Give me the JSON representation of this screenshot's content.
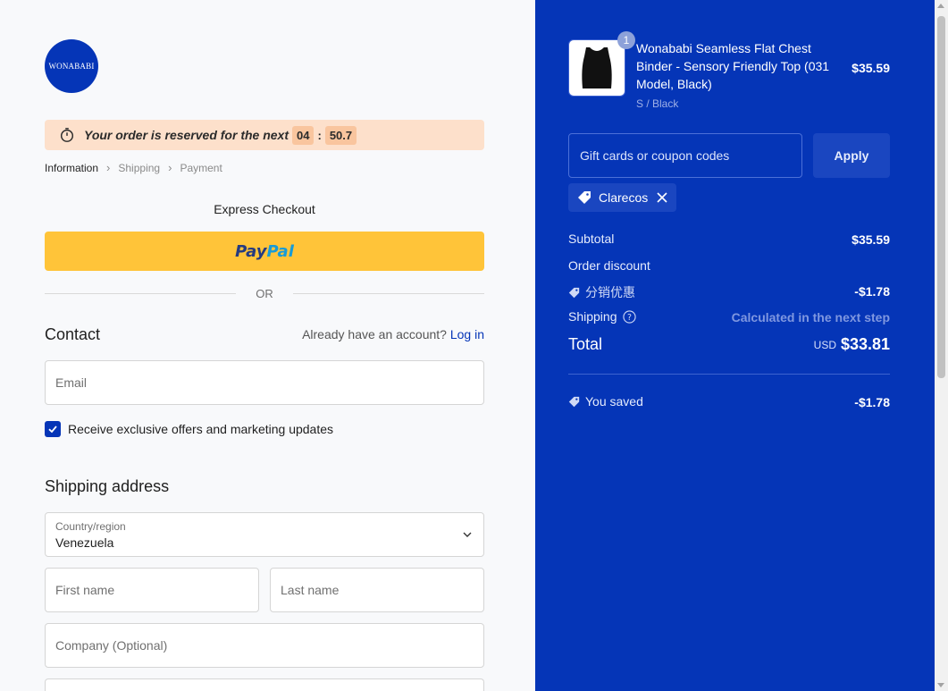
{
  "brand": {
    "logo_text": "WONABABI"
  },
  "timer": {
    "message": "Your order is reserved for the next",
    "minutes": "04",
    "separator": ":",
    "seconds": "50.7"
  },
  "breadcrumb": {
    "items": [
      "Information",
      "Shipping",
      "Payment"
    ]
  },
  "express": {
    "title": "Express Checkout",
    "paypal_pay": "Pay",
    "paypal_pal": "Pal"
  },
  "divider": {
    "or_text": "OR"
  },
  "contact": {
    "title": "Contact",
    "account_prompt": "Already have an account?",
    "login_label": "Log in",
    "email_placeholder": "Email",
    "marketing_label": "Receive exclusive offers and marketing updates",
    "marketing_checked": true
  },
  "shipping": {
    "title": "Shipping address",
    "country_label": "Country/region",
    "country_value": "Venezuela",
    "first_name_placeholder": "First name",
    "last_name_placeholder": "Last name",
    "company_placeholder": "Company (Optional)"
  },
  "summary": {
    "product": {
      "quantity": "1",
      "name": "Wonababi Seamless Flat Chest Binder - Sensory Friendly Top (031 Model, Black)",
      "variant": "S / Black",
      "price": "$35.59"
    },
    "gift_placeholder": "Gift cards or coupon codes",
    "apply_label": "Apply",
    "applied_code": "Clarecos",
    "subtotal_label": "Subtotal",
    "subtotal_value": "$35.59",
    "order_discount_label": "Order discount",
    "discount_name": "分销优惠",
    "discount_value": "-$1.78",
    "shipping_label": "Shipping",
    "shipping_value": "Calculated in the next step",
    "total_label": "Total",
    "total_currency": "USD",
    "total_value": "$33.81",
    "saved_label": "You saved",
    "saved_value": "-$1.78"
  },
  "colors": {
    "brand_blue": "#0535b7",
    "paypal_yellow": "#ffc439",
    "timer_bg": "#fde0cb"
  }
}
